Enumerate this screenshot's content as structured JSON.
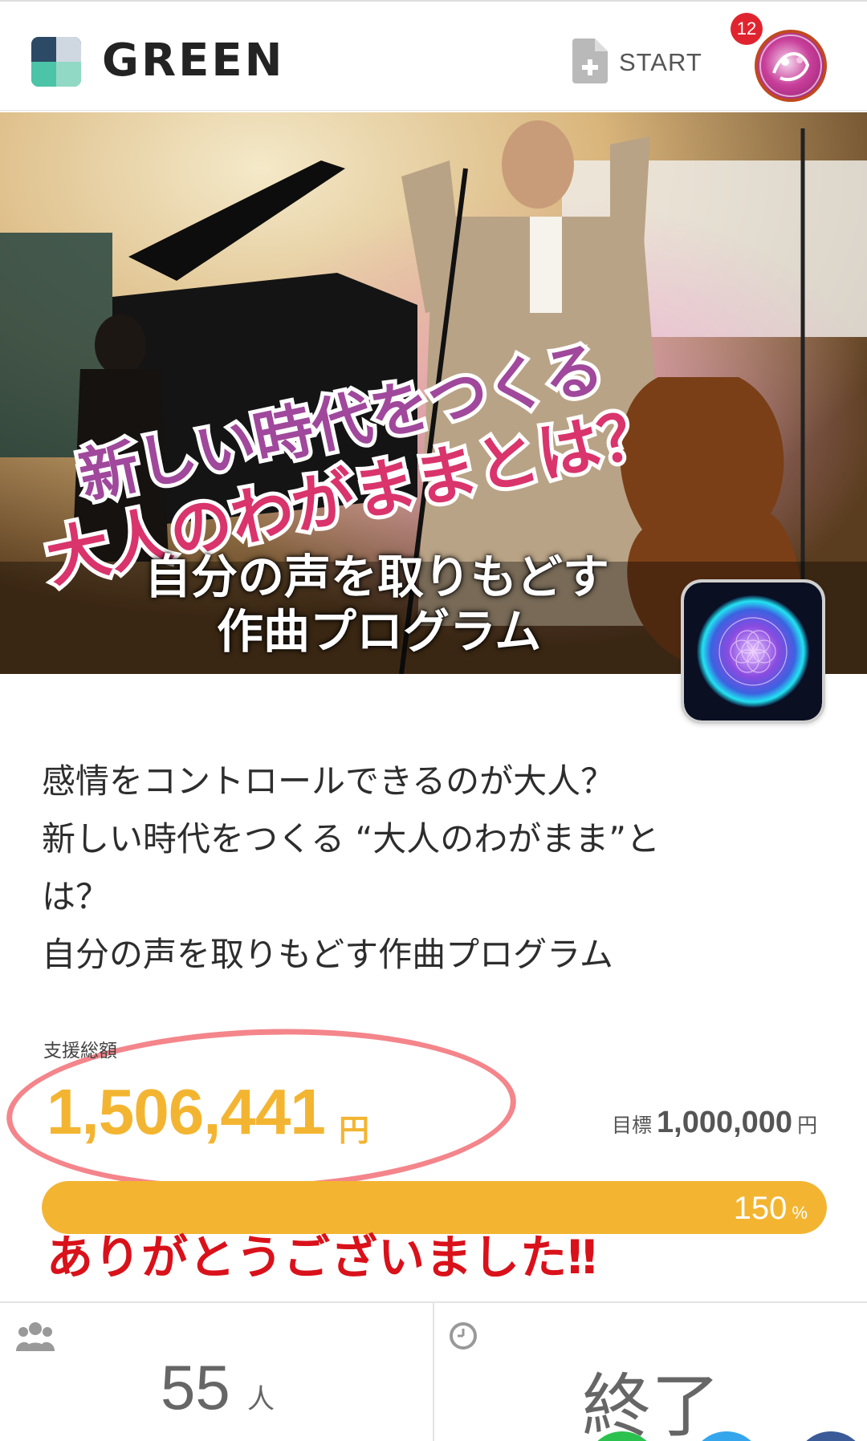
{
  "header": {
    "logo_text": "GREEN",
    "start_label": "START",
    "notification_count": "12"
  },
  "hero": {
    "title_line1": "新しい時代をつくる",
    "title_line2": "大人のわがままとは？",
    "subtitle_line1": "自分の声を取りもどす",
    "subtitle_line2": "作曲プログラム"
  },
  "description": {
    "lines": [
      "感情をコントロールできるのが大人？",
      "新しい時代をつくる “大人のわがまま”と",
      "は？",
      "自分の声を取りもどす作曲プログラム"
    ]
  },
  "funding": {
    "label": "支援総額",
    "amount": "1,506,441",
    "unit": "円",
    "goal_label": "目標",
    "goal_amount": "1,000,000",
    "goal_unit": "円",
    "percent": "150",
    "percent_unit": "%",
    "progress_fraction": 1.0,
    "thanks_text": "ありがとうございました‼"
  },
  "stats": {
    "supporters_value": "55",
    "supporters_unit": "人",
    "status_value": "終了"
  },
  "colors": {
    "accent_yellow": "#f3b531",
    "thanks_red": "#d9111a",
    "circle_pink": "#f4858b",
    "badge_red": "#e0242f"
  },
  "icons": {
    "logo": "green-logo-icon",
    "start": "add-document-icon",
    "supporters": "people-group-icon",
    "clock": "clock-icon"
  }
}
